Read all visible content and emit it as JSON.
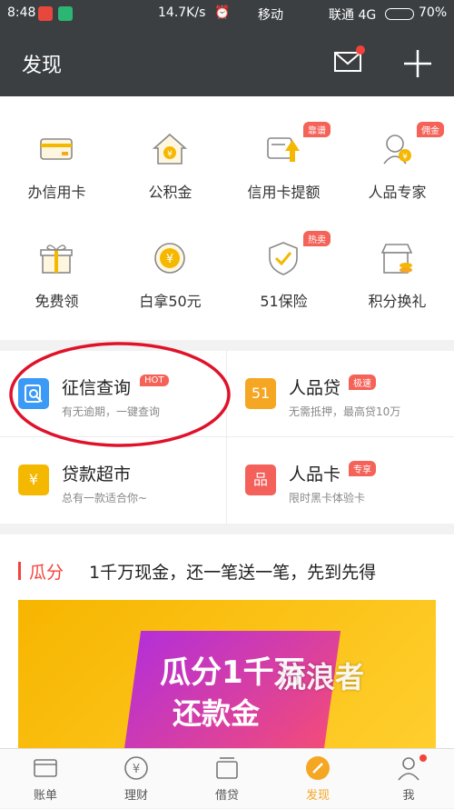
{
  "status": {
    "time": "8:48",
    "speed": "14.7K/s",
    "carrier1": "移动",
    "carrier2": "联通 4G",
    "battery": "70%"
  },
  "header": {
    "title": "发现"
  },
  "grid": [
    {
      "label": "办信用卡",
      "badge": "",
      "icon": "credit-card-icon"
    },
    {
      "label": "公积金",
      "badge": "",
      "icon": "house-yen-icon"
    },
    {
      "label": "信用卡提额",
      "badge": "靠谱",
      "icon": "card-raise-icon"
    },
    {
      "label": "人品专家",
      "badge": "佣金",
      "icon": "expert-icon"
    },
    {
      "label": "免费领",
      "badge": "",
      "icon": "gift-icon"
    },
    {
      "label": "白拿50元",
      "badge": "",
      "icon": "yen-coin-icon"
    },
    {
      "label": "51保险",
      "badge": "热卖",
      "icon": "shield-icon"
    },
    {
      "label": "积分换礼",
      "badge": "",
      "icon": "shop-icon"
    }
  ],
  "services": [
    {
      "title": "征信查询",
      "sub": "有无逾期，一键查询",
      "badge": "HOT",
      "icon_text": "",
      "color": "#3a9af5",
      "icon": "credit-check-icon"
    },
    {
      "title": "人品贷",
      "sub": "无需抵押，最高贷10万",
      "badge": "极速",
      "icon_text": "51",
      "color": "#f5a623",
      "icon": "renpin-loan-icon"
    },
    {
      "title": "贷款超市",
      "sub": "总有一款适合你~",
      "badge": "",
      "icon_text": "¥",
      "color": "#f5b800",
      "icon": "loan-market-icon"
    },
    {
      "title": "人品卡",
      "sub": "限时黑卡体验卡",
      "badge": "专享",
      "icon_text": "品",
      "color": "#f4605a",
      "icon": "renpin-card-icon"
    }
  ],
  "promo": {
    "tag": "瓜分",
    "headline": "1千万现金，还一笔送一笔，先到先得",
    "banner_line1": "瓜分1千万",
    "banner_line2": "还款金",
    "watermark": "流浪者"
  },
  "tabs": [
    {
      "label": "账单",
      "icon": "bill-icon"
    },
    {
      "label": "理财",
      "icon": "finance-icon"
    },
    {
      "label": "借贷",
      "icon": "loan-icon"
    },
    {
      "label": "发现",
      "icon": "discover-icon"
    },
    {
      "label": "我",
      "icon": "profile-icon"
    }
  ],
  "colors": {
    "header": "#3c3f42",
    "accent": "#f5a623",
    "badge": "#f46258",
    "annotation": "#e0122a"
  }
}
